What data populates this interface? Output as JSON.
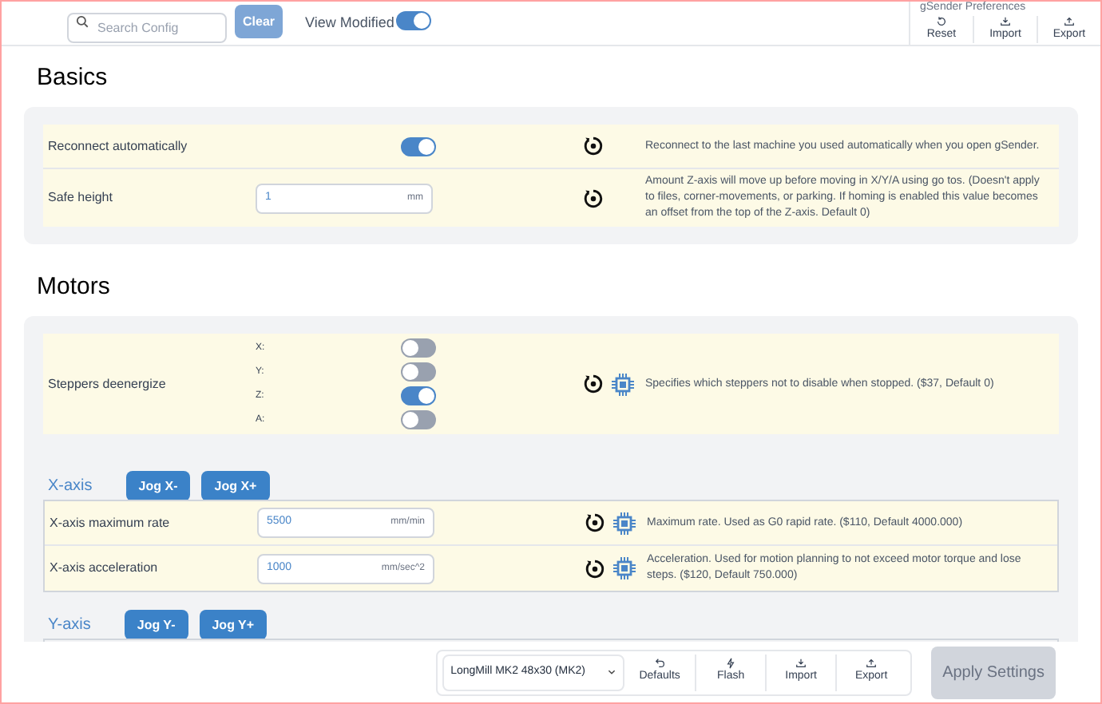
{
  "top_bar": {
    "search": {
      "placeholder": "Search Config"
    },
    "clear_button": "Clear",
    "view_modified": {
      "label": "View Modified",
      "on": true
    },
    "preferences_title": "gSender Preferences",
    "actions": [
      {
        "label": "Reset",
        "kind": "reset"
      },
      {
        "label": "Import",
        "kind": "import"
      },
      {
        "label": "Export",
        "kind": "export"
      }
    ]
  },
  "sections": [
    {
      "title": "Basics",
      "groups": [
        {
          "rows": [
            {
              "kind": "toggle",
              "label": "Reconnect automatically",
              "on": true,
              "firmware": false,
              "description": "Reconnect to the last machine you used automatically when you open gSender."
            },
            {
              "kind": "number",
              "label": "Safe height",
              "value": "1",
              "unit": "mm",
              "firmware": false,
              "description": "Amount Z-axis will move up before moving in X/Y/A using go tos. (Doesn't apply to files, corner-movements, or parking. If homing is enabled this value becomes an offset from the top of the Z-axis. Default 0)"
            }
          ]
        }
      ]
    },
    {
      "title": "Motors",
      "groups": [
        {
          "rows": [
            {
              "kind": "multi_toggle",
              "label": "Steppers deenergize",
              "firmware": true,
              "toggles": [
                {
                  "label": "X:",
                  "on": false
                },
                {
                  "label": "Y:",
                  "on": false
                },
                {
                  "label": "Z:",
                  "on": true
                },
                {
                  "label": "A:",
                  "on": false
                }
              ],
              "description": "Specifies which steppers not to disable when stopped. ($37, Default 0)"
            }
          ]
        },
        {
          "title": "X-axis",
          "jog_buttons": [
            "Jog X-",
            "Jog X+"
          ],
          "rows": [
            {
              "kind": "number",
              "label": "X-axis maximum rate",
              "value": "5500",
              "unit": "mm/min",
              "firmware": true,
              "description": "Maximum rate. Used as G0 rapid rate. ($110, Default 4000.000)"
            },
            {
              "kind": "number",
              "label": "X-axis acceleration",
              "value": "1000",
              "unit": "mm/sec^2",
              "firmware": true,
              "description": "Acceleration. Used for motion planning to not exceed motor torque and lose steps. ($120, Default 750.000)"
            }
          ]
        },
        {
          "title": "Y-axis",
          "jog_buttons": [
            "Jog Y-",
            "Jog Y+"
          ]
        }
      ]
    }
  ],
  "bottom_bar": {
    "profile": "LongMill MK2 48x30 (MK2)",
    "actions": [
      {
        "label": "Defaults",
        "kind": "defaults"
      },
      {
        "label": "Flash",
        "kind": "flash"
      },
      {
        "label": "Import",
        "kind": "import"
      },
      {
        "label": "Export",
        "kind": "export"
      }
    ],
    "apply_button": {
      "label": "Apply Settings",
      "disabled": true
    }
  }
}
